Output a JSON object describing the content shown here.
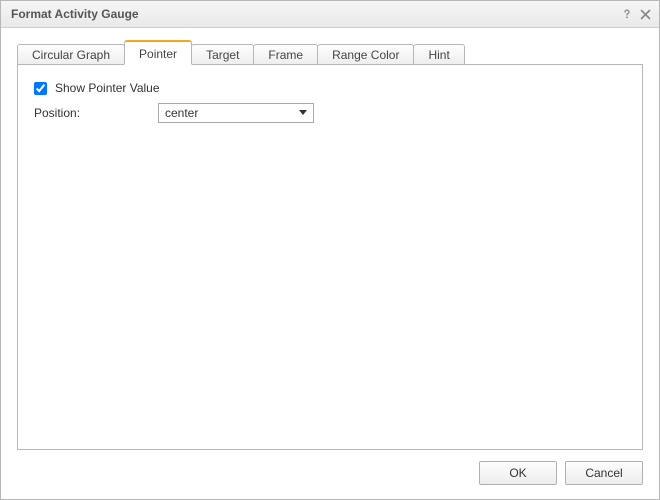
{
  "title": "Format Activity Gauge",
  "tabs": [
    {
      "label": "Circular Graph"
    },
    {
      "label": "Pointer"
    },
    {
      "label": "Target"
    },
    {
      "label": "Frame"
    },
    {
      "label": "Range Color"
    },
    {
      "label": "Hint"
    }
  ],
  "active_tab_index": 1,
  "pointer_panel": {
    "show_pointer_value_label": "Show Pointer Value",
    "show_pointer_value_checked": true,
    "position_label": "Position:",
    "position_value": "center"
  },
  "buttons": {
    "ok": "OK",
    "cancel": "Cancel"
  }
}
